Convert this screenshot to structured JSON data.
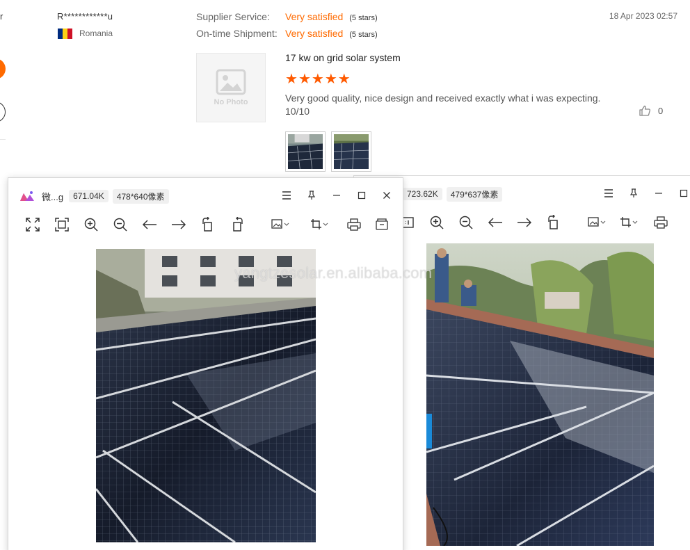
{
  "left_edge": {
    "text_fragment": "r"
  },
  "review": {
    "reviewer_name": "R************u",
    "country": "Romania",
    "flag_colors": [
      "#002b7f",
      "#fcd116",
      "#ce1126"
    ],
    "ratings": [
      {
        "label": "Supplier Service:",
        "value": "Very satisfied",
        "stars_text": "(5 stars)"
      },
      {
        "label": "On-time Shipment:",
        "value": "Very satisfied",
        "stars_text": "(5 stars)"
      }
    ],
    "date": "18 Apr 2023 02:57",
    "no_photo_text": "No Photo",
    "product_title": "17 kw on grid solar system",
    "star_count": 5,
    "review_text": "Very good quality, nice design and received exactly what i was expecting. 10/10",
    "helpful_count": "0",
    "thumbnails": [
      "solar-panel-photo-1",
      "solar-panel-photo-2"
    ]
  },
  "viewer_front": {
    "file_name": "微...g",
    "file_size": "671.04K",
    "dimensions": "478*640像素",
    "toolbar_icons": [
      "fit-screen-icon",
      "actual-size-icon",
      "zoom-in-icon",
      "zoom-out-icon",
      "arrow-left-icon",
      "arrow-right-icon",
      "rotate-left-icon",
      "rotate-right-icon",
      "image-edit-icon",
      "crop-icon",
      "print-icon",
      "save-icon"
    ]
  },
  "viewer_back": {
    "file_size": "723.62K",
    "dimensions": "479*637像素"
  },
  "watermark": "yangtzesolar.en.alibaba.com",
  "colors": {
    "accent": "#ff6a00",
    "star": "#ff5a00",
    "panel": "#1f2a3f"
  }
}
